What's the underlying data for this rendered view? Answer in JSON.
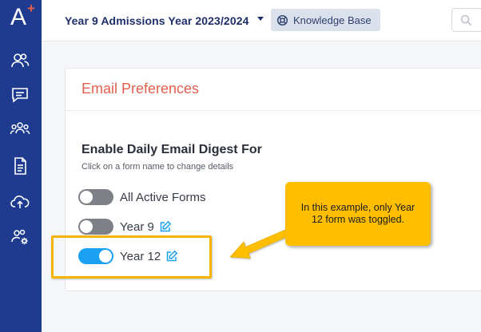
{
  "app": {
    "logo_letter": "A",
    "logo_plus": "+"
  },
  "sidebar": {
    "items": [
      {
        "name": "contacts",
        "icon": "people-icon"
      },
      {
        "name": "messages",
        "icon": "message-icon"
      },
      {
        "name": "groups",
        "icon": "group-icon"
      },
      {
        "name": "documents",
        "icon": "document-icon"
      },
      {
        "name": "upload",
        "icon": "cloud-upload-icon"
      },
      {
        "name": "user-settings",
        "icon": "users-gear-icon"
      }
    ]
  },
  "topbar": {
    "form_selector": "Year 9 Admissions Year 2023/2024",
    "knowledge_base": "Knowledge Base",
    "search_icon": "search-icon"
  },
  "card": {
    "title": "Email Preferences",
    "section_title": "Enable Daily Email Digest For",
    "section_subtitle": "Click on a form name to change details",
    "toggles": [
      {
        "label": "All Active Forms",
        "on": false,
        "editable": false
      },
      {
        "label": "Year 9",
        "on": false,
        "editable": true
      },
      {
        "label": "Year 12",
        "on": true,
        "editable": true
      }
    ]
  },
  "annotation": {
    "callout_text": "In this example, only Year 12 form was toggled."
  },
  "colors": {
    "sidebar": "#1e3b8f",
    "accent_title": "#e2604d",
    "toggle_on": "#1aa1f2",
    "toggle_off": "#7d8087",
    "callout": "#ffbf00"
  }
}
